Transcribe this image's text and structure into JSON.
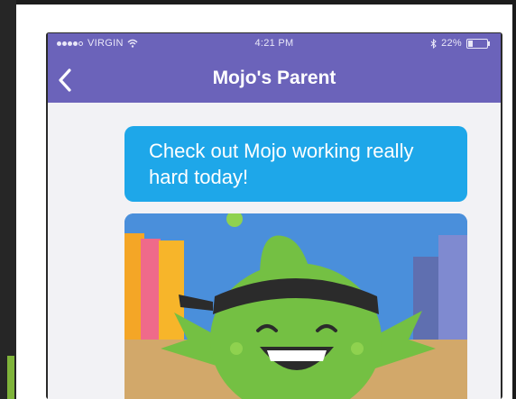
{
  "status_bar": {
    "carrier": "VIRGIN",
    "time": "4:21 PM",
    "battery": "22%"
  },
  "header": {
    "back_icon": "chevron-left-icon",
    "title": "Mojo's Parent"
  },
  "message": {
    "text": "Check out Mojo working really hard today!"
  },
  "image": {
    "subject": "mojo-monster-illustration",
    "colors": {
      "sky": "#4a8fdb",
      "desk": "#d2a86a",
      "monster": "#74c043",
      "headband": "#2b2b2b"
    }
  },
  "colors": {
    "navbar": "#6b63ba",
    "bubble": "#1ea7e9",
    "background": "#f2f2f5"
  }
}
